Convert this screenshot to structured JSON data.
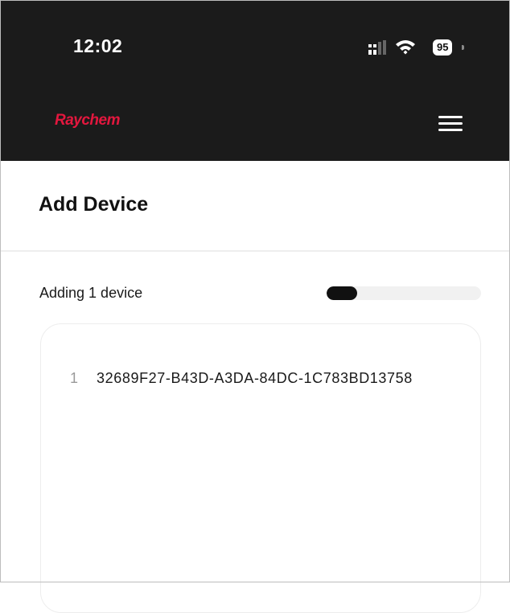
{
  "status_bar": {
    "time": "12:02",
    "battery": "95"
  },
  "header": {
    "brand": "Raychem"
  },
  "page": {
    "title": "Add Device"
  },
  "progress": {
    "label": "Adding 1 device",
    "fraction": 0.2
  },
  "devices": [
    {
      "index": "1",
      "id": "32689F27-B43D-A3DA-84DC-1C783BD13758"
    }
  ]
}
